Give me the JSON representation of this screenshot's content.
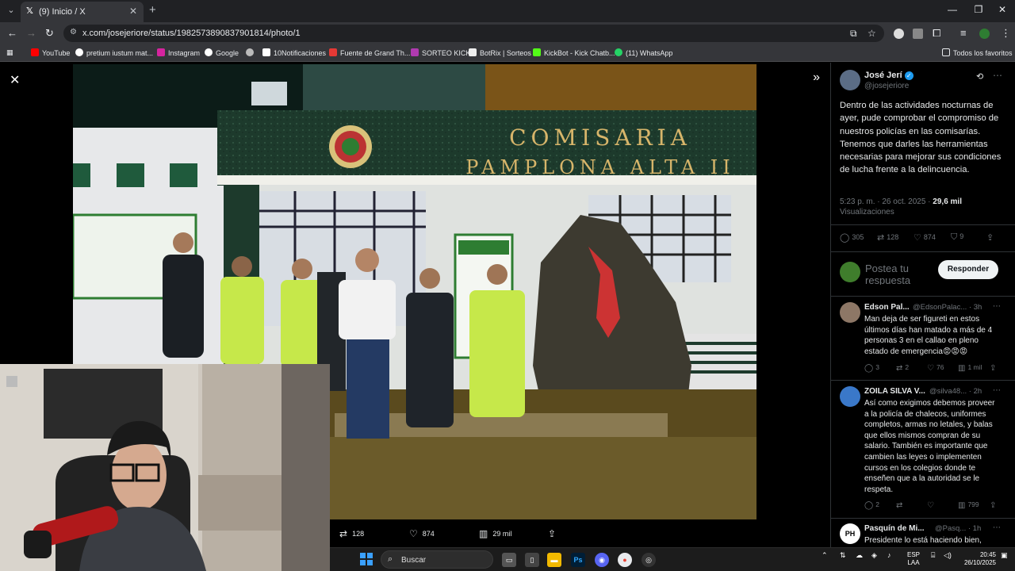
{
  "browser": {
    "tab_title": "(9) Inicio / X",
    "url": "x.com/josejeriore/status/1982573890837901814/photo/1",
    "bookmarks": [
      "YouTube",
      "pretium iustum mat...",
      "Instagram",
      "Google",
      "",
      "10Notificaciones",
      "Fuente de Grand Th...",
      "SORTEO KICK",
      "BotRix | Sorteos",
      "KickBot - Kick Chatb...",
      "(11) WhatsApp"
    ],
    "all_favorites": "Todos los favoritos"
  },
  "photo_stats": {
    "retweets": "128",
    "likes": "874",
    "views": "29 mil"
  },
  "photo_signage": {
    "line1": "COMISARIA",
    "line2": "PAMPLONA ALTA II"
  },
  "post": {
    "author_name": "José Jerí",
    "author_handle": "@josejeriore",
    "text": "Dentro de las actividades nocturnas de ayer, pude comprobar el compromiso de nuestros policías en las comisarías. Tenemos que darles las herramientas necesarias para mejorar sus condiciones de lucha frente a la delincuencia.",
    "timestamp": "5:23 p. m. · 26 oct. 2025 · ",
    "views_count": "29,6 mil",
    "views_label": "Visualizaciones",
    "replies": "305",
    "retweets": "128",
    "likes": "874",
    "bookmarks": "9"
  },
  "reply_box": {
    "placeholder": "Postea tu respuesta",
    "button": "Responder"
  },
  "comments": [
    {
      "name": "Edson Pal...",
      "handle": "@EdsonPalac...",
      "time": "· 3h",
      "text": "Man deja de ser figureti en estos últimos días han matado a más de 4 personas 3 en el callao en pleno estado de emergencia😡😡😡",
      "replies": "3",
      "retweets": "2",
      "likes": "76",
      "views": "1 mil"
    },
    {
      "name": "ZOILA SILVA V...",
      "handle": "@silva48...",
      "time": "· 2h",
      "text": "Así como exigimos debemos proveer a la policía de chalecos, uniformes completos, armas no letales, y balas que ellos mismos compran de su salario. También es importante que cambien las leyes o implementen cursos en los colegios donde te enseñen que a la autoridad se le respeta.",
      "replies": "2",
      "retweets": "",
      "likes": "",
      "views": "799"
    },
    {
      "name": "Pasquín de Mi...",
      "handle": "@Pasq...",
      "time": "· 1h",
      "text": "Presidente lo está haciendo bien,"
    }
  ],
  "taskbar": {
    "search": "Buscar",
    "lang_top": "ESP",
    "lang_bottom": "LAA",
    "time": "20:45",
    "date": "26/10/2025"
  },
  "colors": {
    "accent": "#1d9bf0",
    "background": "#000000",
    "muted": "#71767b"
  }
}
